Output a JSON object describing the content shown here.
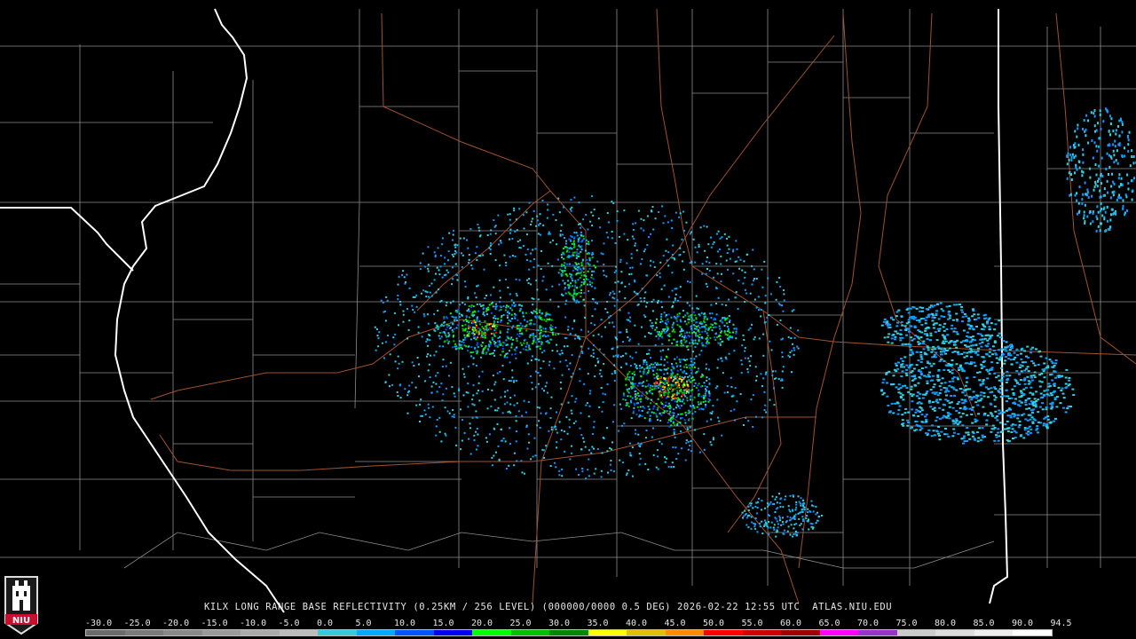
{
  "map": {
    "radar_id": "KILX",
    "title_line": "KILX LONG RANGE BASE REFLECTIVITY (0.25KM / 256 LEVEL) (000000/0000 0.5 DEG) 2026-02-22 12:55 UTC  ATLAS.NIU.EDU",
    "logo_text": "NIU"
  },
  "scale": {
    "labels": [
      "-30.0",
      "-25.0",
      "-20.0",
      "-15.0",
      "-10.0",
      "-5.0",
      "0.0",
      "5.0",
      "10.0",
      "15.0",
      "20.0",
      "25.0",
      "30.0",
      "35.0",
      "40.0",
      "45.0",
      "50.0",
      "55.0",
      "60.0",
      "65.0",
      "70.0",
      "75.0",
      "80.0",
      "85.0",
      "90.0",
      "94.5"
    ],
    "colors": [
      "#6b6b6b",
      "#7a7a7a",
      "#8a8a8a",
      "#9a9a9a",
      "#ababab",
      "#bcbcbc",
      "#39c9d9",
      "#00aaff",
      "#0055ff",
      "#0000ee",
      "#00ff00",
      "#00c000",
      "#008800",
      "#ffff00",
      "#e0c000",
      "#ff8c00",
      "#ff0000",
      "#d00000",
      "#a00000",
      "#ff00ff",
      "#9933cc",
      "#cccccc",
      "#dddddd",
      "#eeeeee",
      "#ffffff"
    ]
  },
  "colors": {
    "state_border": "#ffffff",
    "county_border": "#9a9a9a",
    "highway": "#a0522d"
  }
}
